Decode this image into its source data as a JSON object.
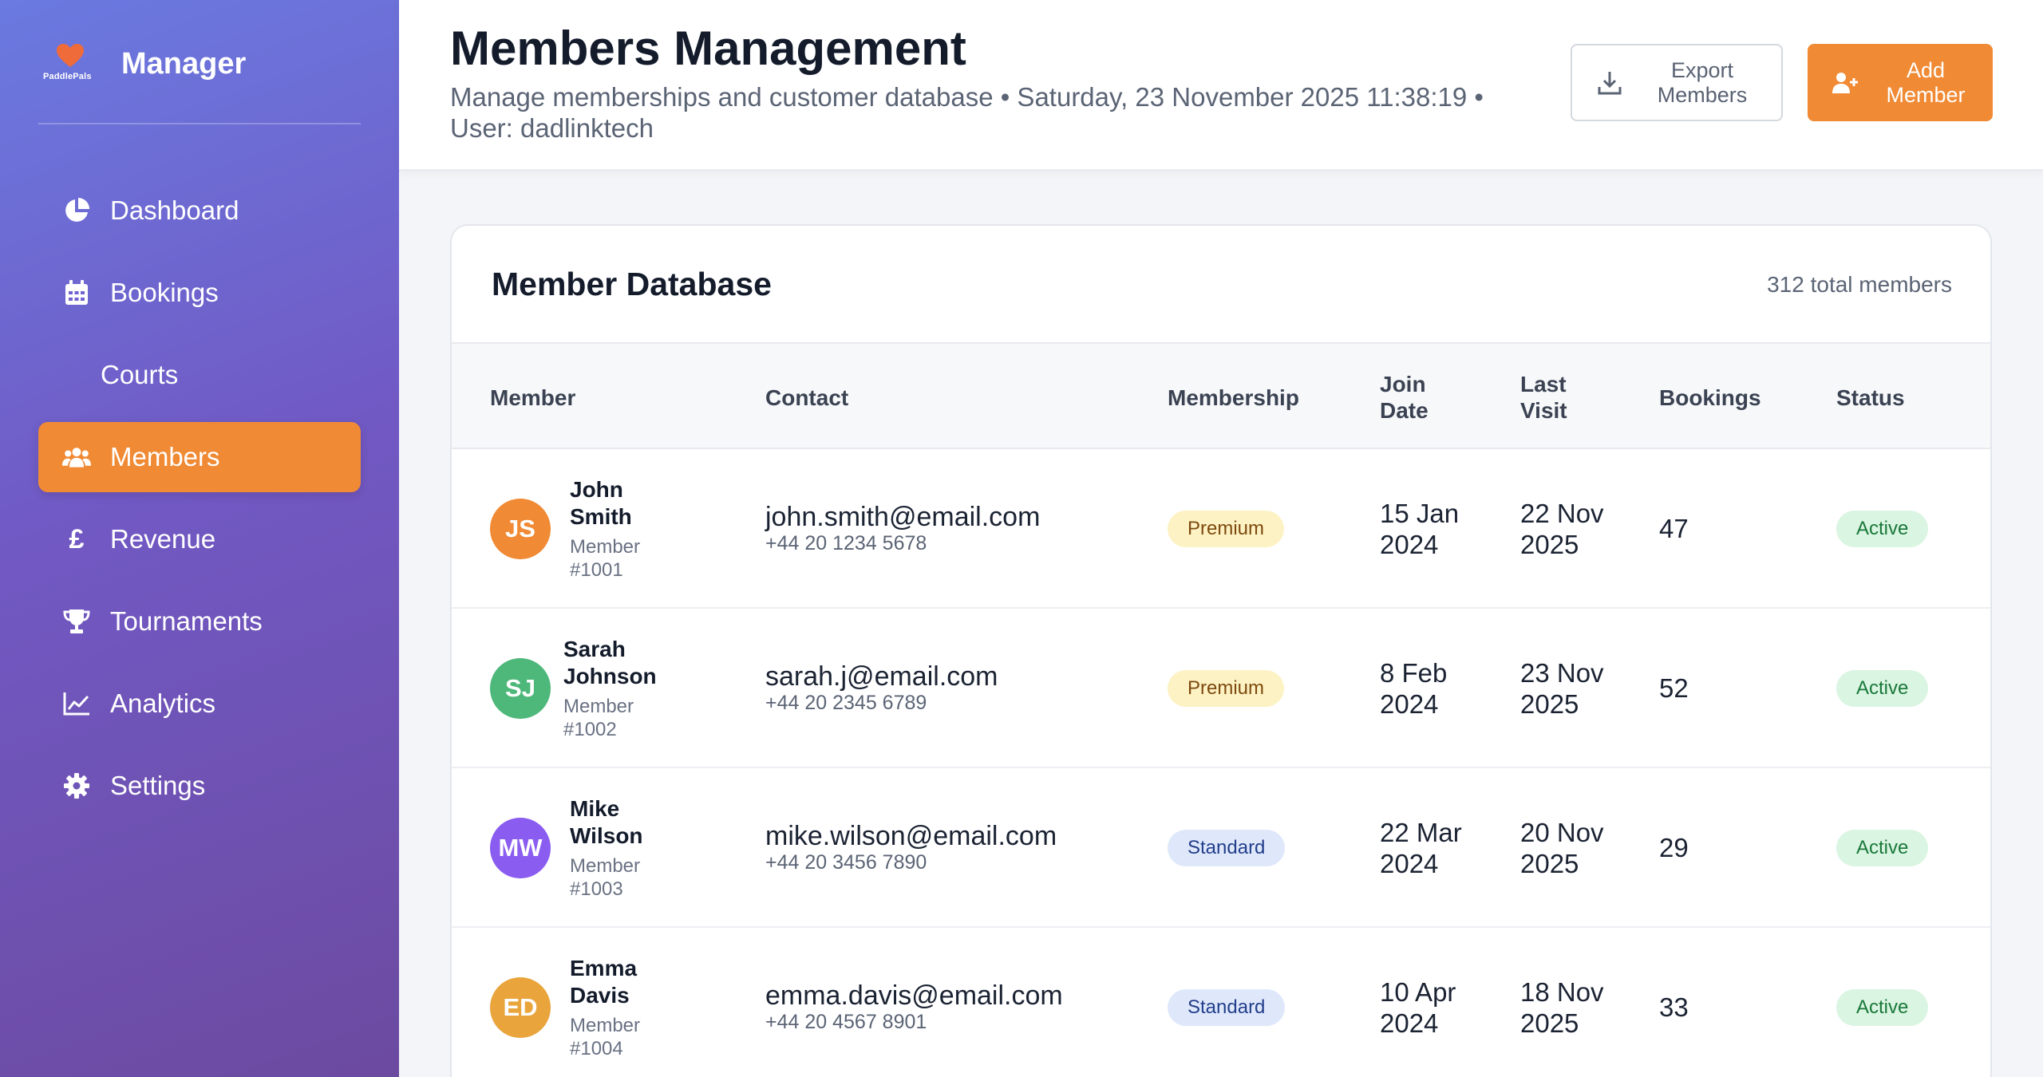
{
  "brand": {
    "name": "Manager",
    "logo_text": "PaddlePals",
    "logo_icon": "heart-logo-icon"
  },
  "sidebar": {
    "items": [
      {
        "label": "Dashboard",
        "icon": "pie-chart-icon",
        "active": false
      },
      {
        "label": "Bookings",
        "icon": "calendar-icon",
        "active": false
      },
      {
        "label": "Courts",
        "icon": "",
        "active": false
      },
      {
        "label": "Members",
        "icon": "users-icon",
        "active": true
      },
      {
        "label": "Revenue",
        "icon": "pound-icon",
        "active": false
      },
      {
        "label": "Tournaments",
        "icon": "trophy-icon",
        "active": false
      },
      {
        "label": "Analytics",
        "icon": "line-chart-icon",
        "active": false
      },
      {
        "label": "Settings",
        "icon": "gear-icon",
        "active": false
      }
    ]
  },
  "header": {
    "title": "Members Management",
    "subtitle": "Manage memberships and customer database • Saturday, 23 November 2025 11:38:19 • User: dadlinktech",
    "export_label": "Export Members",
    "add_label": "Add Member"
  },
  "table": {
    "title": "Member Database",
    "count": "312 total members",
    "columns": {
      "member": "Member",
      "contact": "Contact",
      "membership": "Membership",
      "join_date": "Join Date",
      "last_visit": "Last Visit",
      "bookings": "Bookings",
      "status": "Status"
    },
    "rows": [
      {
        "initials": "JS",
        "avatar_color": "#f08a34",
        "name": "John Smith",
        "member_id": "Member #1001",
        "email": "john.smith@email.com",
        "phone": "+44 20 1234 5678",
        "membership": "Premium",
        "join_date": "15 Jan 2024",
        "last_visit": "22 Nov 2025",
        "bookings": "47",
        "status": "Active"
      },
      {
        "initials": "SJ",
        "avatar_color": "#4db87a",
        "name": "Sarah Johnson",
        "member_id": "Member #1002",
        "email": "sarah.j@email.com",
        "phone": "+44 20 2345 6789",
        "membership": "Premium",
        "join_date": "8 Feb 2024",
        "last_visit": "23 Nov 2025",
        "bookings": "52",
        "status": "Active"
      },
      {
        "initials": "MW",
        "avatar_color": "#8a5cf0",
        "name": "Mike Wilson",
        "member_id": "Member #1003",
        "email": "mike.wilson@email.com",
        "phone": "+44 20 3456 7890",
        "membership": "Standard",
        "join_date": "22 Mar 2024",
        "last_visit": "20 Nov 2025",
        "bookings": "29",
        "status": "Active"
      },
      {
        "initials": "ED",
        "avatar_color": "#e9a43c",
        "name": "Emma Davis",
        "member_id": "Member #1004",
        "email": "emma.davis@email.com",
        "phone": "+44 20 4567 8901",
        "membership": "Standard",
        "join_date": "10 Apr 2024",
        "last_visit": "18 Nov 2025",
        "bookings": "33",
        "status": "Active"
      }
    ]
  },
  "colors": {
    "accent": "#f08a34",
    "sidebar_start": "#6a7ae0",
    "sidebar_end": "#6c4aa0"
  }
}
